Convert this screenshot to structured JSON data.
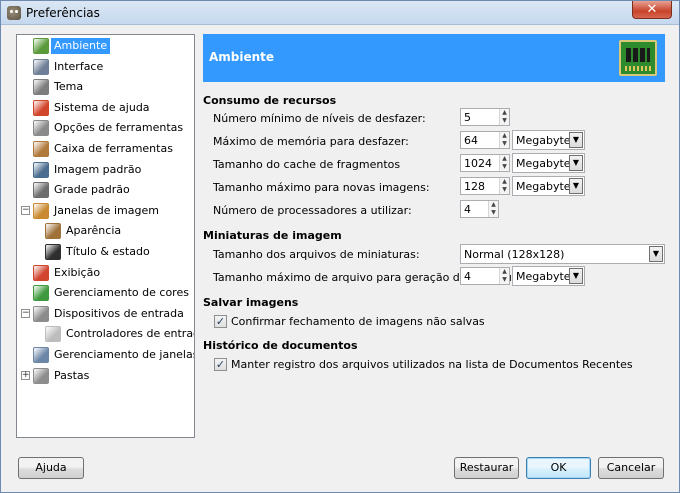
{
  "window": {
    "title": "Preferências",
    "close_glyph": "✕"
  },
  "sidebar": {
    "items": [
      {
        "label": "Ambiente",
        "icon": "environment-icon",
        "color": "#5a9a3a",
        "selected": true
      },
      {
        "label": "Interface",
        "icon": "interface-icon",
        "color": "#6f7f97"
      },
      {
        "label": "Tema",
        "icon": "theme-icon",
        "color": "#7d7d7d"
      },
      {
        "label": "Sistema de ajuda",
        "icon": "help-icon",
        "color": "#d2452a"
      },
      {
        "label": "Opções de ferramentas",
        "icon": "tool-options-icon",
        "color": "#8a8a8a"
      },
      {
        "label": "Caixa de ferramentas",
        "icon": "toolbox-icon",
        "color": "#b07a3c"
      },
      {
        "label": "Imagem padrão",
        "icon": "default-image-icon",
        "color": "#4a6c8f"
      },
      {
        "label": "Grade padrão",
        "icon": "default-grid-icon",
        "color": "#6d6d6d"
      },
      {
        "label": "Janelas de imagem",
        "icon": "image-windows-icon",
        "color": "#c98a32",
        "expander": "−"
      },
      {
        "label": "Aparência",
        "icon": "appearance-icon",
        "color": "#a0723a"
      },
      {
        "label": "Título & estado",
        "icon": "title-status-icon",
        "color": "#2f2f2f"
      },
      {
        "label": "Exibição",
        "icon": "display-icon",
        "color": "#d1452f"
      },
      {
        "label": "Gerenciamento de cores",
        "icon": "color-management-icon",
        "color": "#3f9a3f"
      },
      {
        "label": "Dispositivos de entrada",
        "icon": "input-devices-icon",
        "color": "#8c8c8c",
        "expander": "−"
      },
      {
        "label": "Controladores de entrada",
        "icon": "input-controllers-icon",
        "color": "#bdbdbd"
      },
      {
        "label": "Gerenciamento de janelas",
        "icon": "window-management-icon",
        "color": "#6c86a8"
      },
      {
        "label": "Pastas",
        "icon": "folders-icon",
        "color": "#8d8d8d",
        "expander": "+"
      }
    ]
  },
  "header": {
    "title": "Ambiente",
    "icon": "memory-chip-icon"
  },
  "resources": {
    "title": "Consumo de recursos",
    "undo_levels": {
      "label": "Número mínimo de níveis de desfazer:",
      "value": "5"
    },
    "undo_memory": {
      "label": "Máximo de memória para desfazer:",
      "value": "64",
      "unit": "Megabytes"
    },
    "tile_cache": {
      "label": "Tamanho do cache de fragmentos",
      "value": "1024",
      "unit": "Megabytes"
    },
    "max_new_image": {
      "label": "Tamanho máximo para novas imagens:",
      "value": "128",
      "unit": "Megabytes"
    },
    "processors": {
      "label": "Número de processadores a utilizar:",
      "value": "4"
    }
  },
  "thumbnails": {
    "title": "Miniaturas de imagem",
    "size": {
      "label": "Tamanho dos arquivos de miniaturas:",
      "value": "Normal (128x128)"
    },
    "max_file": {
      "label": "Tamanho máximo de arquivo para geração de miniaturas:",
      "value": "4",
      "unit": "Megabytes"
    }
  },
  "save": {
    "title": "Salvar imagens",
    "confirm_close": {
      "label": "Confirmar fechamento de imagens não salvas",
      "checked": true
    }
  },
  "history": {
    "title": "Histórico de documentos",
    "keep_record": {
      "label": "Manter registro dos arquivos utilizados na lista de Documentos Recentes",
      "checked": true
    }
  },
  "buttons": {
    "help": "Ajuda",
    "reset": "Restaurar",
    "ok": "OK",
    "cancel": "Cancelar"
  },
  "glyphs": {
    "spin_up": "▲",
    "spin_down": "▼",
    "combo_arrow": "▼",
    "check": "✓"
  }
}
